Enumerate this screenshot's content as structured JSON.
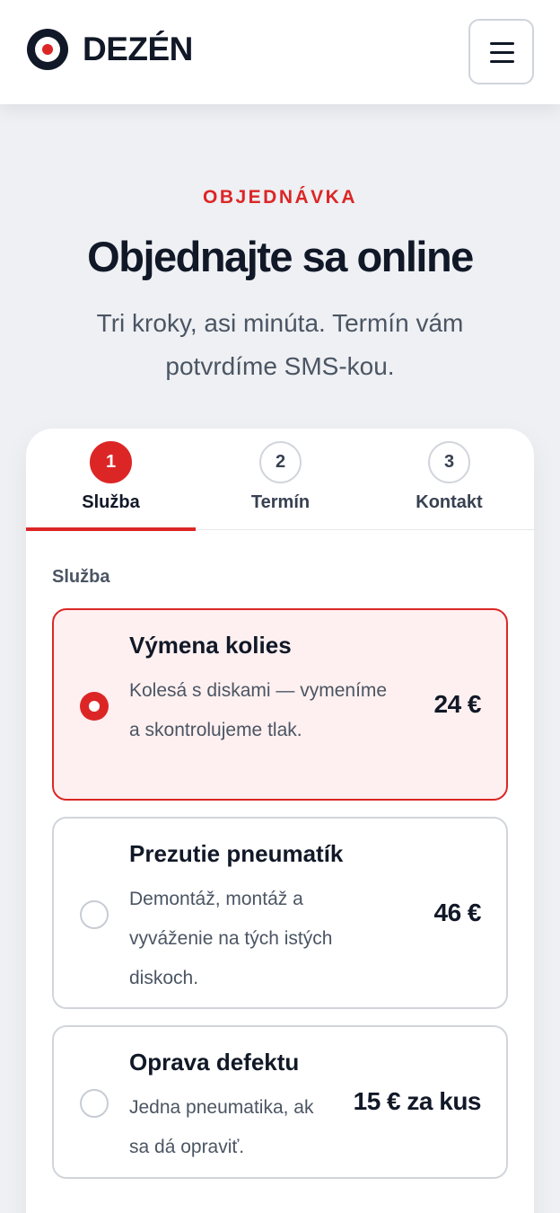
{
  "header": {
    "brand": "DEZÉN",
    "logo_icon": "target-logo-icon",
    "menu_icon": "hamburger-menu-icon"
  },
  "intro": {
    "eyebrow": "OBJEDNÁVKA",
    "title": "Objednajte sa online",
    "subtitle": "Tri kroky, asi minúta. Termín vám potvrdíme SMS-kou."
  },
  "steps": [
    {
      "number": "1",
      "label": "Služba",
      "active": true
    },
    {
      "number": "2",
      "label": "Termín",
      "active": false
    },
    {
      "number": "3",
      "label": "Kontakt",
      "active": false
    }
  ],
  "service_section": {
    "label": "Služba",
    "options": [
      {
        "title": "Výmena kolies",
        "description": "Kolesá s diskami — vymeníme a skontrolujeme tlak.",
        "price": "24 €",
        "selected": true
      },
      {
        "title": "Prezutie pneumatík",
        "description": "Demontáž, montáž a vyváženie na tých istých diskoch.",
        "price": "46 €",
        "selected": false
      },
      {
        "title": "Oprava defektu",
        "description": "Jedna pneumatika, ak sa dá opraviť.",
        "price": "15 € za kus",
        "selected": false
      }
    ]
  },
  "colors": {
    "accent": "#dc2626",
    "text": "#111827",
    "muted": "#4b5563",
    "page_background": "#eef0f3",
    "selected_background": "#fef0f0"
  }
}
